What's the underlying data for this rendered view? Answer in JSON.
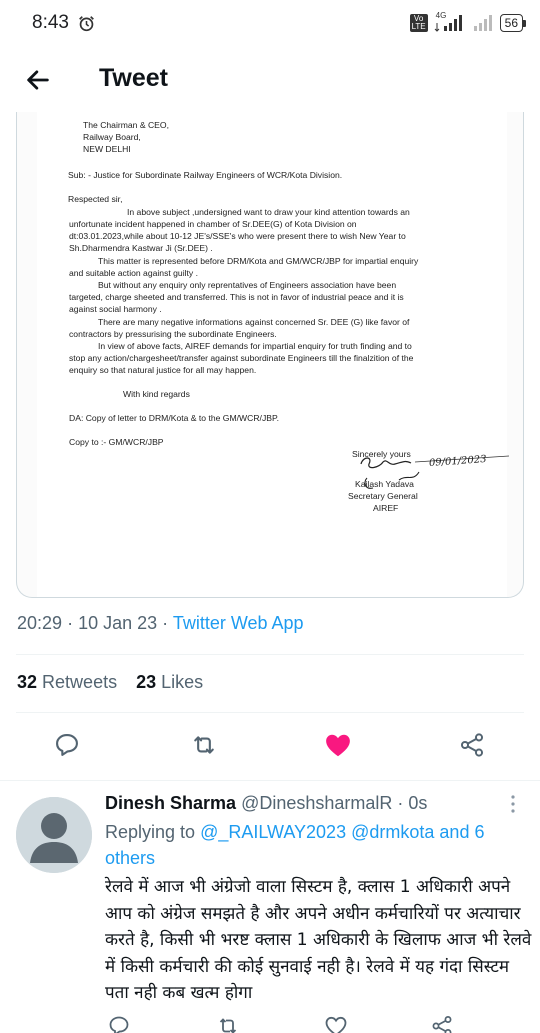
{
  "status_bar": {
    "time": "8:43",
    "network_label": "4G",
    "volte_top": "Vo",
    "volte_bottom": "LTE",
    "battery": "56"
  },
  "header": {
    "title": "Tweet"
  },
  "document": {
    "address": [
      "The Chairman  & CEO,",
      "Railway Board,",
      "NEW DELHI"
    ],
    "subject": "Sub: - Justice for Subordinate Railway Engineers of WCR/Kota Division.",
    "salutation": "Respected sir,",
    "para1": [
      "In above subject ,undersigned want to draw your kind attention towards an",
      "unfortunate incident happened in chamber of Sr.DEE(G) of Kota Division on",
      "dt:03.01.2023,while about 10-12 JE's/SSE's who were present there to wish New Year to",
      "Sh.Dharmendra Kastwar Ji (Sr.DEE) ."
    ],
    "para2": [
      "This matter is represented before DRM/Kota and GM/WCR/JBP for impartial  enquiry",
      "and suitable action against guilty ."
    ],
    "para3": [
      "But without any enquiry only reprentatives of Engineers association have been",
      "targeted, charge sheeted and transferred. This is not in favor of industrial peace and it is",
      "against social harmony ."
    ],
    "para4": [
      "There are many negative informations against concerned Sr. DEE (G) like favor of",
      "contractors by pressurising the subordinate Engineers."
    ],
    "para5": [
      "In view of above facts, AIREF demands for impartial enquiry for truth finding and to",
      "stop any action/chargesheet/transfer against subordinate Engineers till the finalzition of the",
      "enquiry so that natural justice for all may happen."
    ],
    "regards": "With kind regards",
    "da": "DA: Copy of letter to DRM/Kota & to the GM/WCR/JBP.",
    "copy_to": "Copy to :- GM/WCR/JBP",
    "sincerely": "Sincerely yours",
    "signature_date": "09/01/2023",
    "signer_name": "Kailash Yadava",
    "signer_title": "Secretary General",
    "signer_org": "AIREF"
  },
  "tweet": {
    "time": "20:29",
    "date": "10 Jan 23",
    "source": "Twitter Web App",
    "retweets_count": "32",
    "retweets_label": "Retweets",
    "likes_count": "23",
    "likes_label": "Likes",
    "liked": true,
    "like_color": "#f91880"
  },
  "reply": {
    "name": "Dinesh Sharma",
    "handle": "@DineshsharmalR",
    "time": "0s",
    "replying_prefix": "Replying to",
    "mention1": "@_RAILWAY2023",
    "mention2": "@drmkota",
    "and_others": "and 6 others",
    "text": "रेलवे में आज भी अंग्रेजो वाला सिस्टम है, क्लास 1 अधिकारी अपने आप को अंग्रेज समझते है और अपने अधीन कर्मचारियों पर अत्याचार करते है, किसी भी भरष्ट क्लास 1 अधिकारी के खिलाफ आज भी रेलवे में किसी कर्मचारी की कोई सुनवाई नही है। रेलवे में यह गंदा सिस्टम पता नही कब खत्म होगा"
  },
  "colors": {
    "accent": "#1d9bf0",
    "secondary_text": "#536471",
    "primary_text": "#0f1419"
  }
}
